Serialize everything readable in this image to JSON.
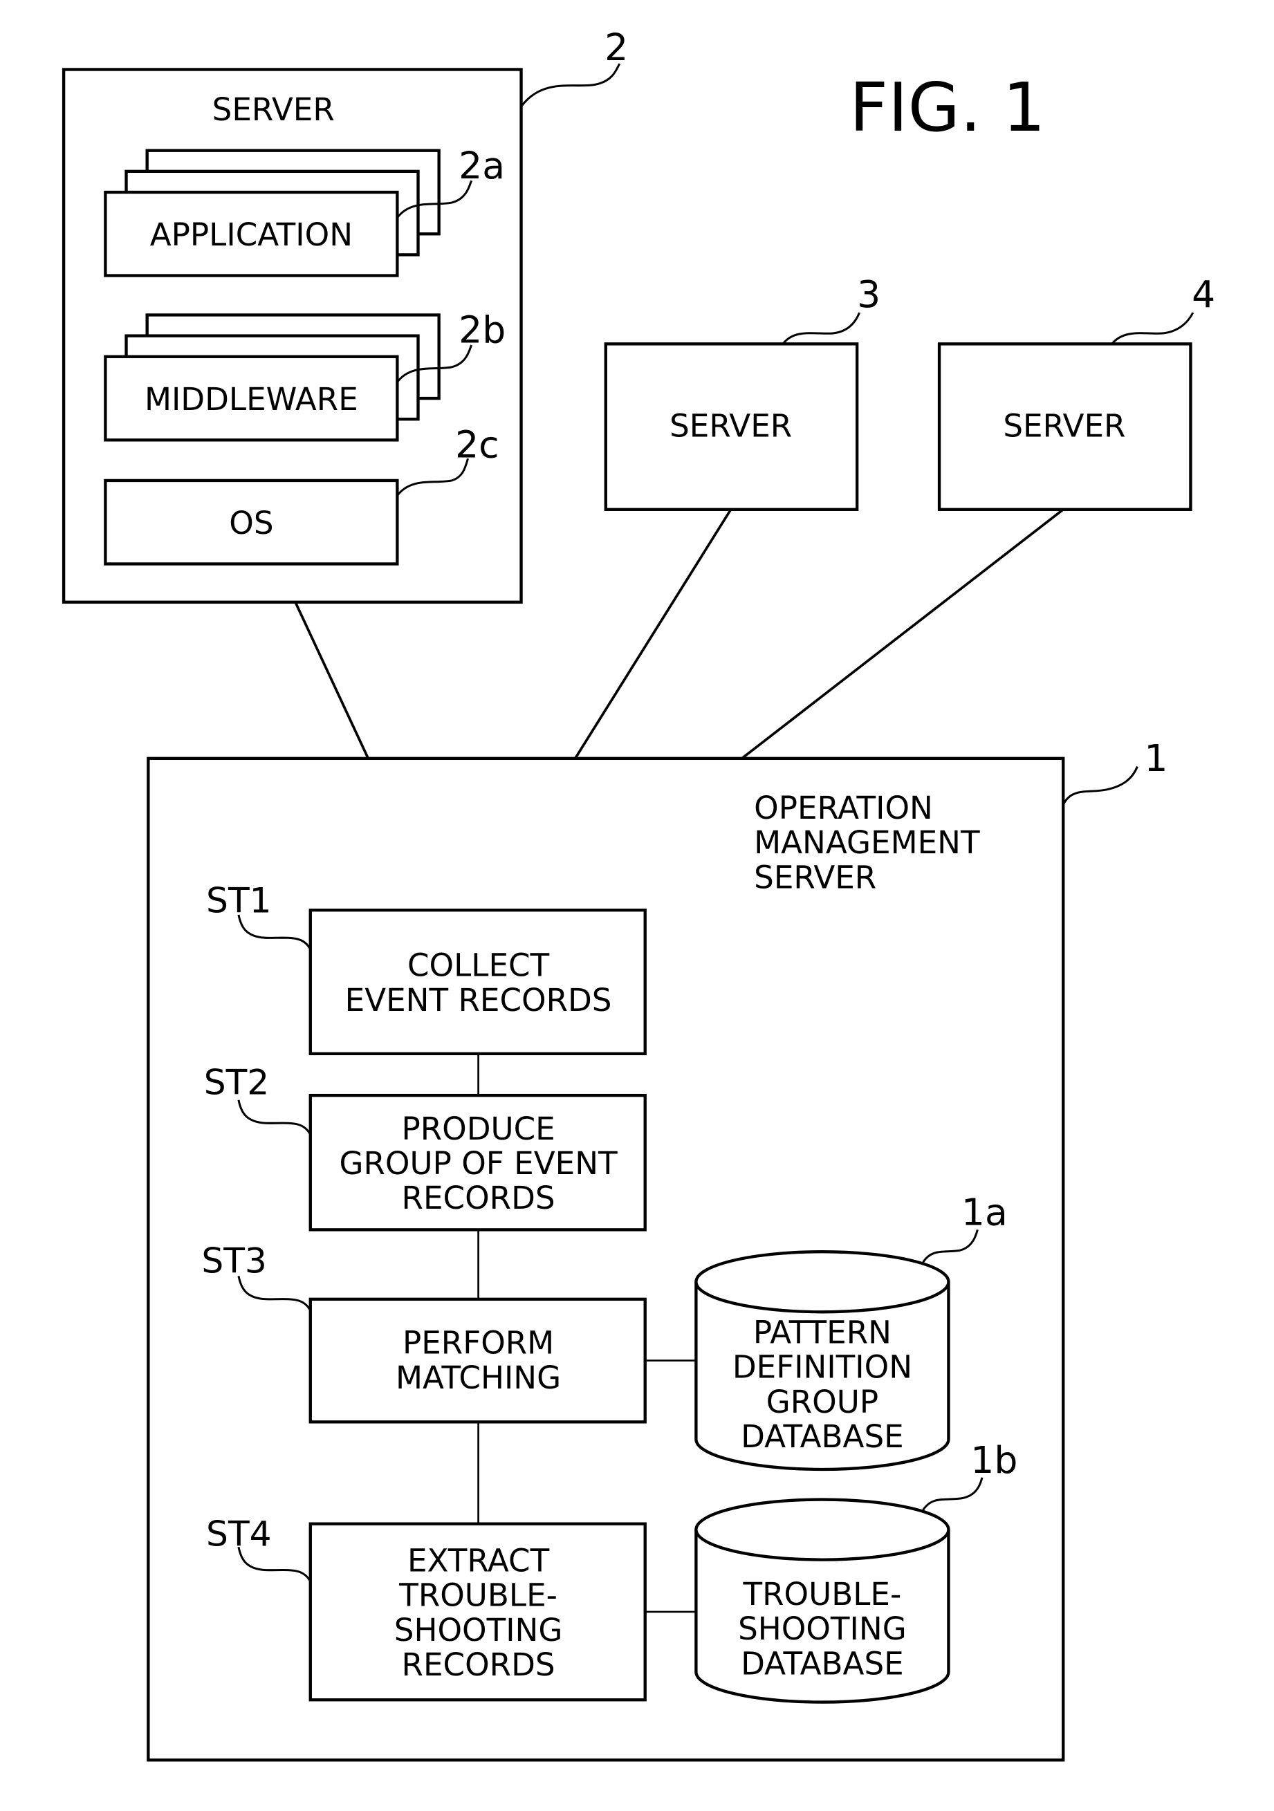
{
  "figure_title": "FIG. 1",
  "server2": {
    "ref": "2",
    "title": "SERVER",
    "application": {
      "ref": "2a",
      "label": "APPLICATION"
    },
    "middleware": {
      "ref": "2b",
      "label": "MIDDLEWARE"
    },
    "os": {
      "ref": "2c",
      "label": "OS"
    }
  },
  "server3": {
    "ref": "3",
    "label": "SERVER"
  },
  "server4": {
    "ref": "4",
    "label": "SERVER"
  },
  "operation_server": {
    "ref": "1",
    "title_lines": [
      "OPERATION",
      "MANAGEMENT",
      "SERVER"
    ],
    "steps": [
      {
        "id": "ST1",
        "lines": [
          "COLLECT",
          "EVENT RECORDS"
        ]
      },
      {
        "id": "ST2",
        "lines": [
          "PRODUCE",
          "GROUP OF EVENT",
          "RECORDS"
        ]
      },
      {
        "id": "ST3",
        "lines": [
          "PERFORM",
          "MATCHING"
        ]
      },
      {
        "id": "ST4",
        "lines": [
          "EXTRACT",
          "TROUBLE-",
          "SHOOTING",
          "RECORDS"
        ]
      }
    ],
    "databases": [
      {
        "ref": "1a",
        "lines": [
          "PATTERN",
          "DEFINITION",
          "GROUP",
          "DATABASE"
        ]
      },
      {
        "ref": "1b",
        "lines": [
          "TROUBLE-",
          "SHOOTING",
          "DATABASE"
        ]
      }
    ]
  }
}
